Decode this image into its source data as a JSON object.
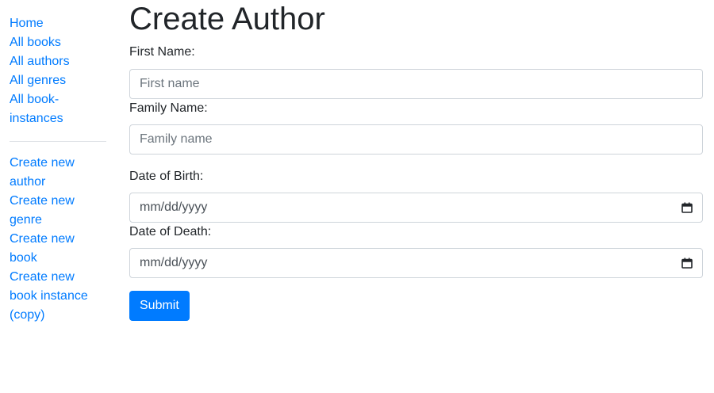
{
  "sidebar": {
    "nav_links": [
      {
        "label": "Home"
      },
      {
        "label": "All books"
      },
      {
        "label": "All authors"
      },
      {
        "label": "All genres"
      },
      {
        "label": "All book-"
      },
      {
        "label": "instances"
      }
    ],
    "create_links": [
      {
        "label": "Create new"
      },
      {
        "label": "author"
      },
      {
        "label": "Create new"
      },
      {
        "label": "genre"
      },
      {
        "label": "Create new"
      },
      {
        "label": "book"
      },
      {
        "label": "Create new"
      },
      {
        "label": "book instance"
      },
      {
        "label": "(copy)"
      }
    ]
  },
  "main": {
    "title": "Create Author",
    "fields": {
      "first_name": {
        "label": "First Name:",
        "placeholder": "First name",
        "value": ""
      },
      "family_name": {
        "label": "Family Name:",
        "placeholder": "Family name",
        "value": ""
      },
      "date_of_birth": {
        "label": "Date of Birth:",
        "display": "mm/dd/yyyy"
      },
      "date_of_death": {
        "label": "Date of Death:",
        "display": "mm/dd/yyyy"
      }
    },
    "submit_label": "Submit"
  },
  "colors": {
    "link": "#007bff",
    "button": "#007bff",
    "text": "#212529",
    "border": "#ced4da"
  },
  "icons": {
    "date_picker": "calendar-icon"
  }
}
